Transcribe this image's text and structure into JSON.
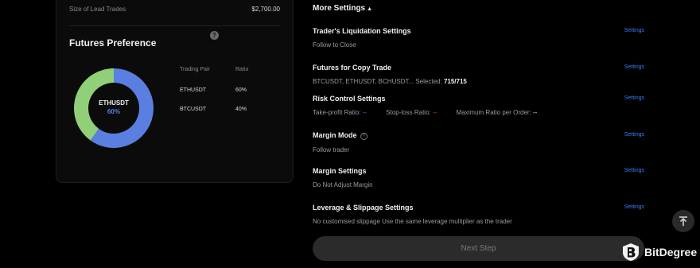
{
  "lead": {
    "label": "Size of Lead Trades",
    "value": "$2,700.00"
  },
  "futures_pref": {
    "title": "Futures Preference",
    "help": "?",
    "donut": {
      "label": "ETHUSDT",
      "pct": "60%",
      "colors": [
        "#5b7fe0",
        "#8fd078"
      ],
      "shares": [
        60,
        40
      ]
    },
    "table": {
      "headers": [
        "Trading Pair",
        "Ratio"
      ],
      "rows": [
        {
          "pair": "ETHUSDT",
          "ratio": "60%"
        },
        {
          "pair": "BTCUSDT",
          "ratio": "40%"
        }
      ]
    }
  },
  "more_settings": {
    "label": "More Settings",
    "caret": "▲"
  },
  "settings_link": "Settings",
  "sections": {
    "liquidation": {
      "title": "Trader's Liquidation Settings",
      "value": "Follow to Close"
    },
    "futures_copy": {
      "title": "Futures for Copy Trade",
      "value": "BTCUSDT, ETHUSDT, BCHUSDT... Selected:",
      "count": "715/715"
    },
    "risk": {
      "title": "Risk Control Settings",
      "tp_label": "Take-profit Ratio:",
      "tp_value": "--",
      "sl_label": "Stop-loss Ratio:",
      "sl_value": "--",
      "max_label": "Maximum Ratio per Order:",
      "max_value": "--"
    },
    "margin_mode": {
      "title": "Margin Mode",
      "info": "?",
      "value": "Follow trader"
    },
    "margin_settings": {
      "title": "Margin Settings",
      "value": "Do Not Adjust Margin"
    },
    "leverage": {
      "title": "Leverage & Slippage Settings",
      "value": "No customised slippage Use the same leverage multiplier as the trader"
    }
  },
  "next_step": "Next Step",
  "brand": {
    "name": "BitDegree"
  },
  "icons": {
    "scroll_top": "arrow-to-top-icon",
    "brand": "bitdegree-shield-icon"
  },
  "colors": {
    "accent": "#3d7bf5",
    "danger": "#e04848"
  }
}
